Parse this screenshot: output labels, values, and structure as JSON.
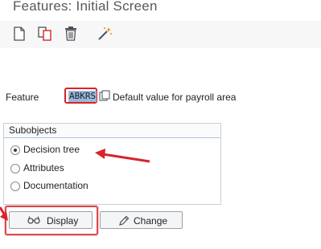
{
  "window": {
    "title": "Features: Initial Screen"
  },
  "toolbar": {
    "icons": [
      "new-document-icon",
      "copy-icon",
      "delete-icon",
      "magic-wand-icon"
    ]
  },
  "feature": {
    "label": "Feature",
    "value": "ABKRS",
    "description": "Default value for payroll area"
  },
  "subobjects": {
    "title": "Subobjects",
    "options": [
      {
        "label": "Decision tree",
        "selected": true
      },
      {
        "label": "Attributes",
        "selected": false
      },
      {
        "label": "Documentation",
        "selected": false
      }
    ]
  },
  "actions": {
    "display_label": "Display",
    "change_label": "Change"
  },
  "colors": {
    "annotation": "#e0474a",
    "selection": "#9eb8d4"
  }
}
